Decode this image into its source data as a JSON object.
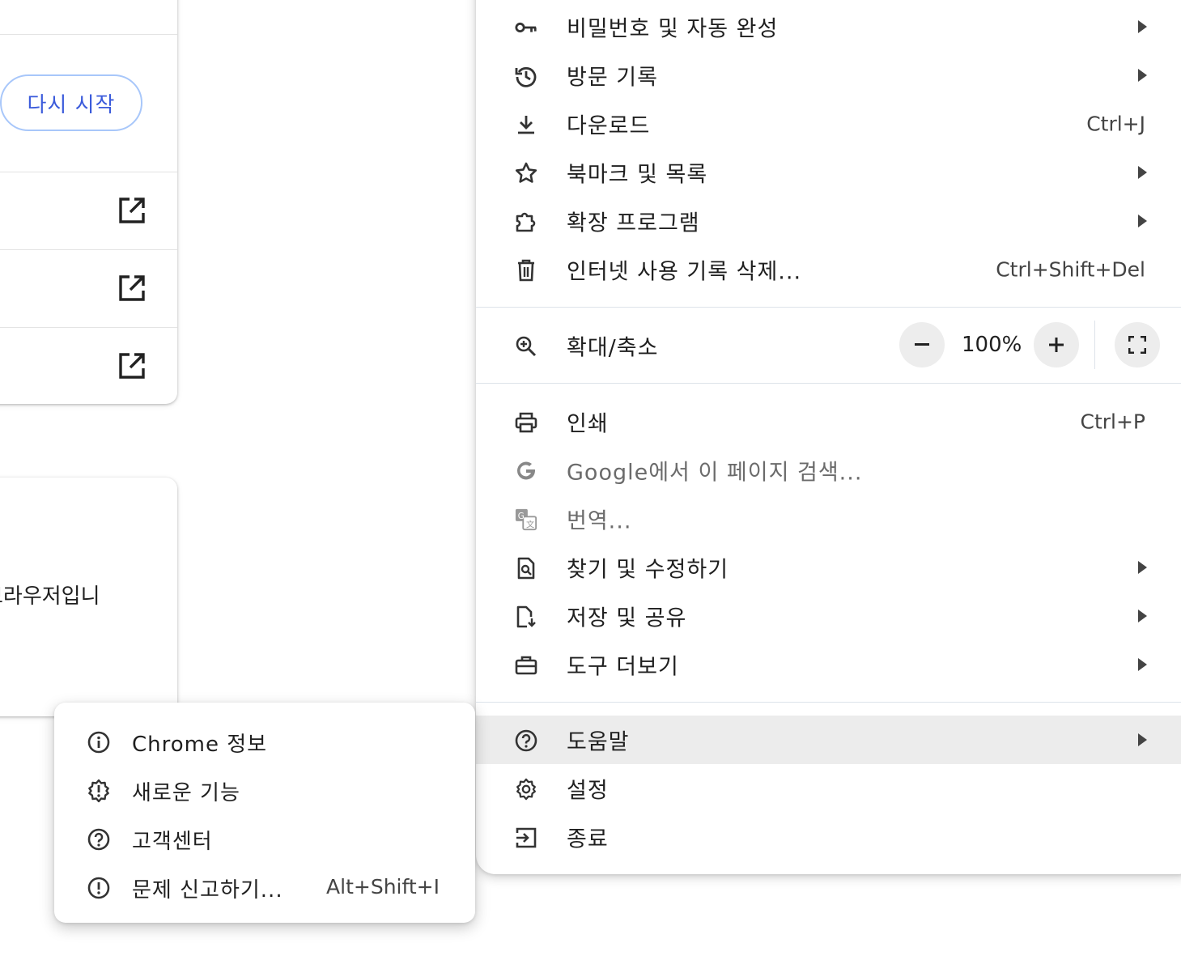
{
  "background": {
    "restart_label": "다시 시작",
    "card2_text": "브라우저입니"
  },
  "menu": {
    "items_top": [
      {
        "label": "비밀번호 및 자동 완성",
        "icon": "key-icon",
        "submenu": true
      },
      {
        "label": "방문 기록",
        "icon": "history-icon",
        "submenu": true
      },
      {
        "label": "다운로드",
        "icon": "download-icon",
        "shortcut": "Ctrl+J"
      },
      {
        "label": "북마크 및 목록",
        "icon": "star-icon",
        "submenu": true
      },
      {
        "label": "확장 프로그램",
        "icon": "extension-icon",
        "submenu": true
      },
      {
        "label": "인터넷 사용 기록 삭제...",
        "icon": "trash-icon",
        "shortcut": "Ctrl+Shift+Del"
      }
    ],
    "zoom": {
      "label": "확대/축소",
      "value": "100%",
      "icon": "zoom-icon"
    },
    "items_mid": [
      {
        "label": "인쇄",
        "icon": "print-icon",
        "shortcut": "Ctrl+P"
      },
      {
        "label": "Google에서 이 페이지 검색...",
        "icon": "google-icon"
      },
      {
        "label": "번역...",
        "icon": "translate-icon"
      },
      {
        "label": "찾기 및 수정하기",
        "icon": "find-icon",
        "submenu": true
      },
      {
        "label": "저장 및 공유",
        "icon": "save-share-icon",
        "submenu": true
      },
      {
        "label": "도구 더보기",
        "icon": "toolbox-icon",
        "submenu": true
      }
    ],
    "items_bottom": [
      {
        "label": "도움말",
        "icon": "help-icon",
        "submenu": true
      },
      {
        "label": "설정",
        "icon": "settings-icon"
      },
      {
        "label": "종료",
        "icon": "exit-icon"
      }
    ]
  },
  "help_submenu": {
    "items": [
      {
        "label": "Chrome 정보",
        "icon": "info-icon"
      },
      {
        "label": "새로운 기능",
        "icon": "new-feature-icon"
      },
      {
        "label": "고객센터",
        "icon": "help-center-icon"
      },
      {
        "label": "문제 신고하기...",
        "icon": "report-issue-icon",
        "shortcut": "Alt+Shift+I"
      }
    ]
  }
}
